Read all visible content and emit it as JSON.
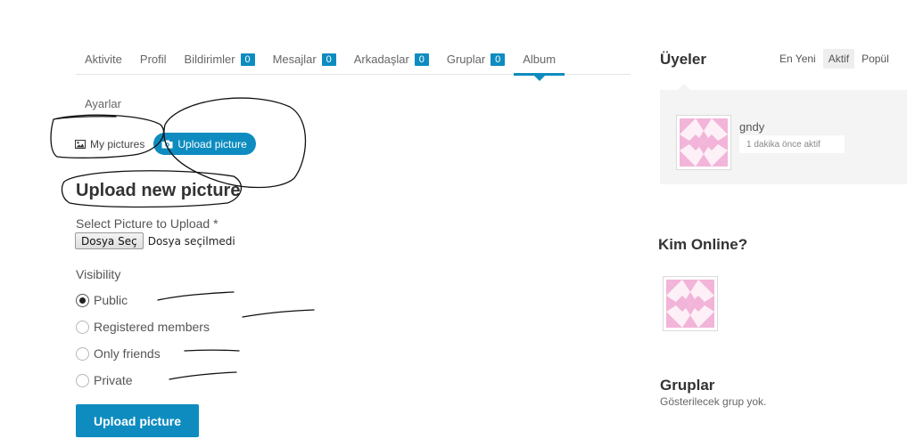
{
  "tabs": [
    {
      "label": "Aktivite",
      "count": null
    },
    {
      "label": "Profil",
      "count": null
    },
    {
      "label": "Bildirimler",
      "count": "0"
    },
    {
      "label": "Mesajlar",
      "count": "0"
    },
    {
      "label": "Arkadaşlar",
      "count": "0"
    },
    {
      "label": "Gruplar",
      "count": "0"
    },
    {
      "label": "Album",
      "count": null,
      "active": true
    }
  ],
  "subnav": {
    "settings": "Ayarlar"
  },
  "picture_menu": {
    "my_pictures": "My pictures",
    "upload_picture": "Upload picture"
  },
  "form": {
    "heading": "Upload new picture",
    "select_label": "Select Picture to Upload *",
    "file_button": "Dosya Seç",
    "file_status": "Dosya seçilmedi",
    "visibility_label": "Visibility",
    "options": [
      "Public",
      "Registered members",
      "Only friends",
      "Private"
    ],
    "selected": "Public",
    "submit": "Upload picture"
  },
  "sidebar": {
    "members_title": "Üyeler",
    "member_tabs": [
      "En Yeni",
      "Aktif",
      "Popül"
    ],
    "active_member_tab": "Aktif",
    "member": {
      "name": "gndy",
      "activity": "1 dakika önce aktif"
    },
    "online_title": "Kim Online?",
    "groups_title": "Gruplar",
    "groups_empty": "Gösterilecek grup yok."
  },
  "colors": {
    "accent": "#0e8cc0",
    "avatar_pink": "#f2b4d8",
    "panel_bg": "#f4f4f4"
  },
  "icons": {
    "my_pictures": "image-icon",
    "upload_picture": "camera-icon"
  }
}
